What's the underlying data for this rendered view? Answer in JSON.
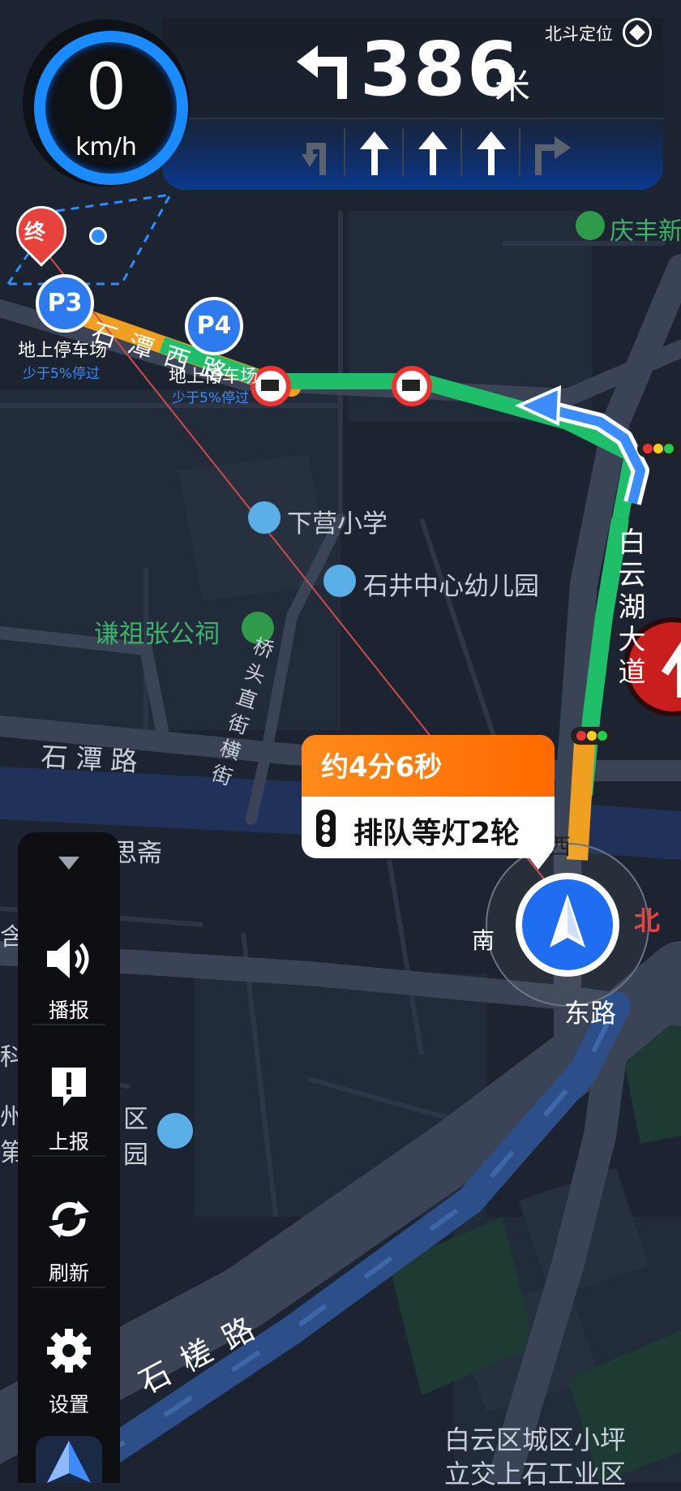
{
  "guidance": {
    "speed_value": "0",
    "speed_unit": "km/h",
    "distance": "386",
    "distance_unit": "米",
    "positioning_label": "北斗定位",
    "turn": "turn-left-icon",
    "lanes": [
      "lane-left-turn-icon",
      "lane-straight-icon",
      "lane-straight-icon",
      "lane-straight-icon",
      "lane-right-turn-icon"
    ]
  },
  "route_info": {
    "eta": "约4分6秒",
    "queue": "排队等灯2轮"
  },
  "compass": {
    "north": "北",
    "south": "南"
  },
  "destination_marker": "终",
  "parking": [
    {
      "badge": "P3",
      "title": "地上停车场",
      "sub": "少于5%停过"
    },
    {
      "badge": "P4",
      "title": "地上停车场",
      "sub": "少于5%停过"
    }
  ],
  "map_labels": {
    "qingfeng": "庆丰新",
    "xiaying_school": "下营小学",
    "shijing_kindergarten": "石井中心幼儿园",
    "qianzu_hall": "谦祖张公祠",
    "shitan_west_road": "石潭西路",
    "shitan_road": "石潭路",
    "baiyunhu_avenue": "白云湖大道",
    "qiaotou_street": "桥头直街横街",
    "sizhai": "思斋",
    "east_road": "东路",
    "xi": "西",
    "shicha_road": "石槎路",
    "bottom_area_line1": "白云区城区小坪",
    "bottom_area_line2": "立交上石工业区",
    "left_fragment_1": "科",
    "left_fragment_2": "州",
    "left_fragment_3": "第",
    "left_fragment_4": "区",
    "left_fragment_5": "园",
    "left_fragment_6": "含"
  },
  "sidebar": {
    "items": [
      {
        "label": "播报",
        "icon": "speaker-icon"
      },
      {
        "label": "上报",
        "icon": "report-icon"
      },
      {
        "label": "刷新",
        "icon": "refresh-icon"
      },
      {
        "label": "设置",
        "icon": "gear-icon"
      }
    ]
  },
  "colors": {
    "route_green": "#1fbf6a",
    "route_orange": "#f0a020",
    "speed_ring": "#1a8cff",
    "eta_orange": "#ff7a10",
    "map_background": "#1b2330"
  }
}
